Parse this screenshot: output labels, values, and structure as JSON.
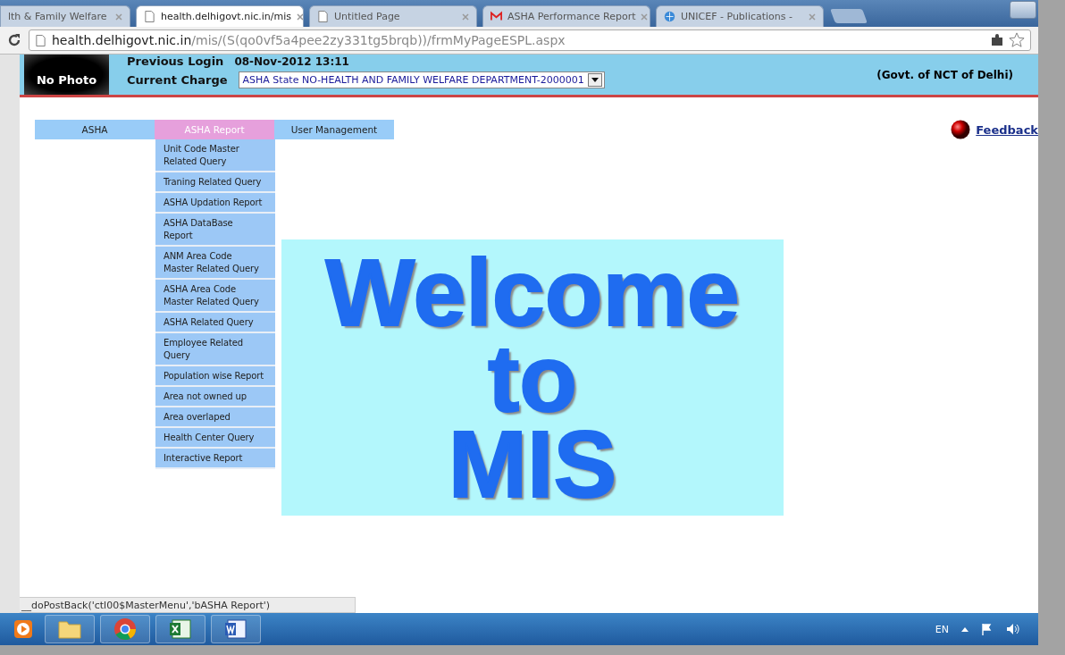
{
  "tabs": [
    {
      "title": "lth & Family Welfare",
      "kind": "none",
      "selected": false
    },
    {
      "title": "health.delhigovt.nic.in/mis",
      "kind": "page",
      "selected": true
    },
    {
      "title": "Untitled Page",
      "kind": "page",
      "selected": false
    },
    {
      "title": "ASHA Performance Report",
      "kind": "mail",
      "selected": false
    },
    {
      "title": "UNICEF - Publications -",
      "kind": "globe",
      "selected": false
    }
  ],
  "address": {
    "host": "health.delhigovt.nic.in",
    "path": "/mis/(S(qo0vf5a4pee2zy331tg5brqb))/frmMyPageESPL.aspx"
  },
  "header": {
    "photo_label": "No Photo",
    "previous_login_label": "Previous Login",
    "previous_login_value": "08-Nov-2012 13:11",
    "current_charge_label": "Current Charge",
    "current_charge_value": "ASHA State NO-HEALTH AND FAMILY WELFARE DEPARTMENT-2000001",
    "govt": "(Govt. of NCT of Delhi)"
  },
  "menu": [
    {
      "label": "ASHA",
      "selected": false
    },
    {
      "label": "ASHA Report",
      "selected": true
    },
    {
      "label": "User Management",
      "selected": false
    }
  ],
  "submenu": [
    "Unit Code Master Related Query",
    "Traning Related Query",
    "ASHA Updation Report",
    "ASHA DataBase Report",
    "ANM Area Code Master Related Query",
    "ASHA Area Code Master Related Query",
    "ASHA Related Query",
    "Employee Related Query",
    "Population wise Report",
    "Area not owned up",
    "Area overlaped",
    "Health Center Query",
    "Interactive Report"
  ],
  "feedback": "Feedback",
  "welcome": [
    "Welcome",
    "to",
    "MIS"
  ],
  "status_text": "__doPostBack('ctl00$MasterMenu','bASHA Report')",
  "tray": {
    "language": "EN"
  }
}
